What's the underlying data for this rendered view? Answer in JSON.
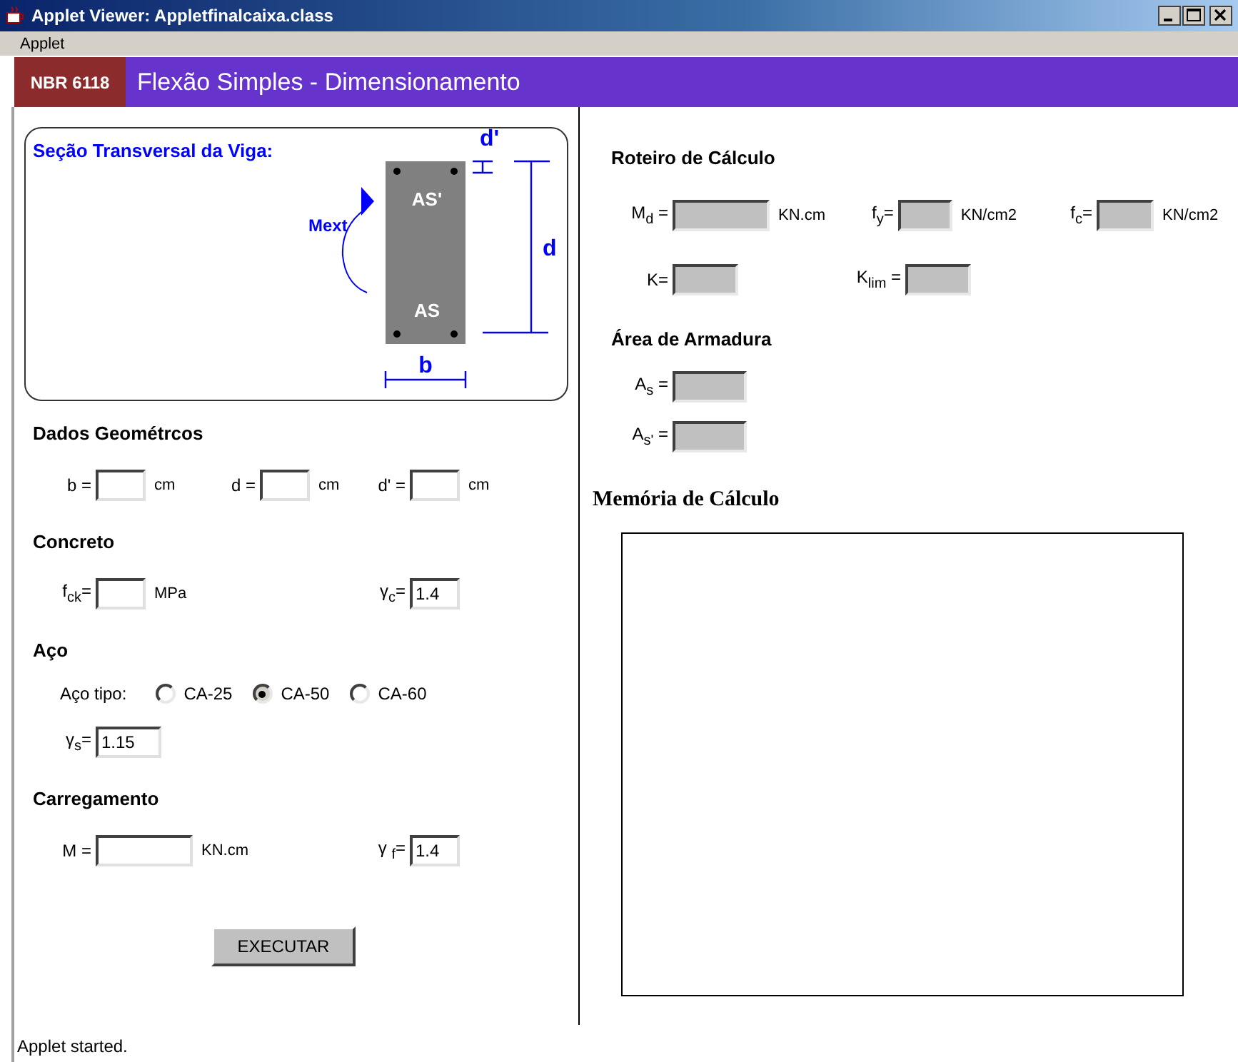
{
  "window": {
    "title": "Applet Viewer: Appletfinalcaixa.class"
  },
  "menu": [
    {
      "label": "Applet"
    }
  ],
  "header": {
    "badge": "NBR 6118",
    "title": "Flexão Simples - Dimensionamento"
  },
  "section_diagram": {
    "title": "Seção Transversal da Viga:",
    "labels": {
      "top_bars": "AS'",
      "bottom_bars": "AS",
      "moment": "Mext",
      "cover": "d'",
      "depth": "d",
      "width": "b"
    }
  },
  "input_sections": [
    {
      "heading": "Dados Geométrcos",
      "rows": [
        [
          {
            "kind": "input",
            "label": "b =",
            "unit": "cm"
          },
          {
            "kind": "input",
            "label": "d =",
            "unit": "cm"
          },
          {
            "kind": "input",
            "label": "d' =",
            "unit": "cm"
          }
        ]
      ]
    },
    {
      "heading": "Concreto",
      "rows": [
        [
          {
            "kind": "input",
            "label": "f$_{ck}$=",
            "unit": "MPa"
          },
          {
            "kind": "input",
            "label": "γ$_{c}$=",
            "value": "1.4"
          }
        ]
      ]
    },
    {
      "heading": "Aço",
      "rows": [
        [
          {
            "kind": "radio_group",
            "label": "Aço tipo:",
            "options": [
              {
                "label": "CA-25",
                "selected": false
              },
              {
                "label": "CA-50",
                "selected": true
              },
              {
                "label": "CA-60",
                "selected": false
              }
            ]
          }
        ],
        [
          {
            "kind": "input",
            "label": "γ$_{s}$=",
            "value": "1.15"
          }
        ]
      ]
    },
    {
      "heading": "Carregamento",
      "rows": [
        [
          {
            "kind": "input",
            "label": "M =",
            "unit": "KN.cm"
          },
          {
            "kind": "input",
            "label": "γ $_{f}$=",
            "value": "1.4"
          }
        ]
      ]
    }
  ],
  "button": "EXECUTAR",
  "results": {
    "heading": "Roteiro de Cálculo",
    "rows": [
      [
        {
          "kind": "output",
          "label": "M$_{d}$ =",
          "unit": "KN.cm"
        },
        {
          "kind": "output",
          "label": "f$_{y}$=",
          "unit": "KN/cm2"
        },
        {
          "kind": "output",
          "label": "f$_{c}$=",
          "unit": "KN/cm2"
        }
      ],
      [
        {
          "kind": "output",
          "label": "K="
        },
        {
          "kind": "output",
          "label": "K$_{lim}$ ="
        }
      ]
    ]
  },
  "reinforcement": {
    "heading": "Área de Armadura",
    "rows": [
      [
        {
          "kind": "output",
          "label": "A$_{s}$ ="
        }
      ],
      [
        {
          "kind": "output",
          "label": "A$_{s'}$ ="
        }
      ]
    ]
  },
  "calculation_memo": {
    "heading": "Memória de Cálculo"
  },
  "status_bar": "Applet started."
}
